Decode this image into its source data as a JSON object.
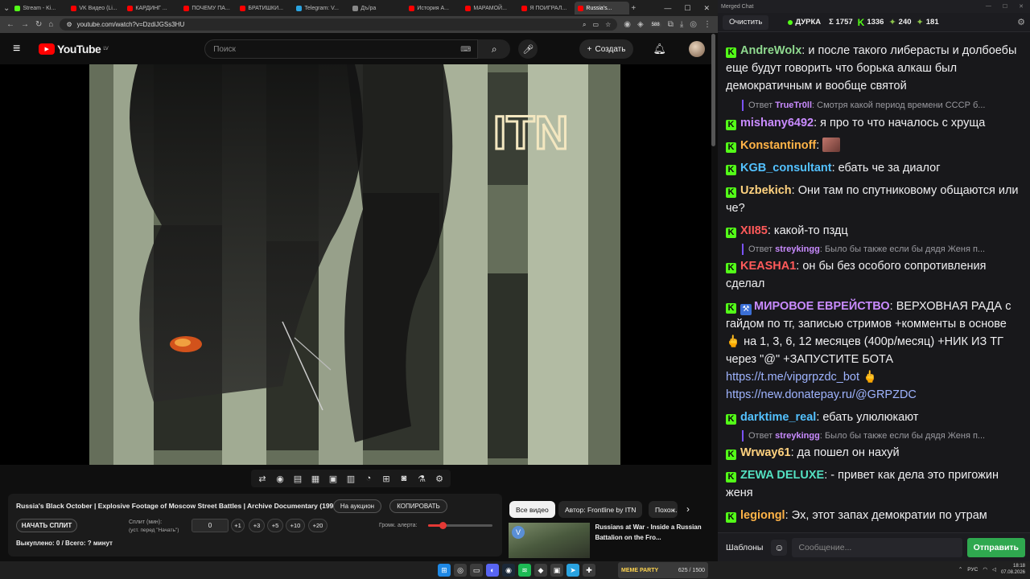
{
  "browser": {
    "tabs": [
      {
        "label": "Stream - Ki...",
        "color": "#53fc18"
      },
      {
        "label": "VK Видео (Li...",
        "color": "#ff0000"
      },
      {
        "label": "КАРДИНГ ...",
        "color": "#ff0000"
      },
      {
        "label": "ПОЧЕМУ ПА...",
        "color": "#ff0000"
      },
      {
        "label": "БРАТИШКИ...",
        "color": "#ff0000"
      },
      {
        "label": "Telegram: V...",
        "color": "#2aa3e0"
      },
      {
        "label": "Дъ/pa",
        "color": "#888888"
      },
      {
        "label": "История А...",
        "color": "#ff0000"
      },
      {
        "label": "МАРАМОЙ...",
        "color": "#ff0000"
      },
      {
        "label": "Я ПОИГРАЛ...",
        "color": "#ff0000"
      },
      {
        "label": "Russia's...",
        "color": "#ff0000"
      }
    ],
    "url": "youtube.com/watch?v=DzdiJGSs3HU",
    "badge": "588"
  },
  "youtube": {
    "logo_text": "YouTube",
    "logo_region": "LV",
    "search_placeholder": "Поиск",
    "create_label": "Создать",
    "video_watermark": "ITN"
  },
  "extension": {
    "video_title": "Russia's Black October | Explosive Footage of Moscow Street Battles | Archive Documentary (1993)",
    "auction_label": "На аукцион",
    "copy_label": "КОПИРОВАТЬ",
    "start_split_label": "НАЧАТЬ СПЛИТ",
    "split_label": "Сплит (мин):",
    "split_hint": "(уст. перед \"Начать\")",
    "split_value": "0",
    "steps": [
      "+1",
      "+3",
      "+5",
      "+10",
      "+20"
    ],
    "alert_volume_label": "Громк. алерта:",
    "alert_volume_percent": 23,
    "bought_label": "Выкуплено: 0 / Всего: ? минут"
  },
  "recommendations": {
    "chips": [
      "Все видео",
      "Автор: Frontline by ITN",
      "Похож..."
    ],
    "video_title": "Russians at War - Inside a Russian Battalion on the Fro..."
  },
  "taskbar": {
    "game_label": "MEME PARTY",
    "game_progress": "625 / 1500",
    "lang": "РУС",
    "time": "18:18",
    "date": "07.08.2026"
  },
  "chat": {
    "window_title": "Merged Chat",
    "clear_label": "Очистить",
    "channel": "ДУРКА",
    "stat_total": "Σ 1757",
    "stat_kick": "1336",
    "stat_a": "240",
    "stat_b": "181",
    "messages": [
      {
        "user": "AndreWolx",
        "color": "#8fd98f",
        "text": "и после такого либерасты и долбоебы еще будут говорить что борька алкаш был демократичным и вообще святой"
      },
      {
        "reply_user": "TrueTr0ll",
        "reply_text": "Смотря какой период времени СССР б..."
      },
      {
        "user": "mishany6492",
        "color": "#c98bff",
        "text": "я про то что началось с хруща"
      },
      {
        "user": "Konstantinoff",
        "color": "#ffb347",
        "text": ""
      },
      {
        "user": "KGB_consultant",
        "color": "#53c1ff",
        "text": "ебать  че за диалог"
      },
      {
        "user": "Uzbekich",
        "color": "#ffd27f",
        "text": "Они там по спутниковому общаются или че?"
      },
      {
        "user": "XII85",
        "color": "#ff5a5a",
        "text": "какой-то пздц"
      },
      {
        "reply_user": "streykingg",
        "reply_text": "Было бы также если бы дядя Женя п..."
      },
      {
        "user": "KEASHA1",
        "color": "#ff5a5a",
        "text": "он бы без особого сопротивления сделал"
      },
      {
        "user": "МИРОВОЕ ЕВРЕЙСТВО",
        "color": "#c98bff",
        "text": "ВЕРХОВНАЯ РАДА с гайдом по тг, записью стримов +комменты в основе 🖕 на 1, 3, 6, 12 месяцев (400р/месяц) +НИК ИЗ ТГ через \"@\" +ЗАПУСТИТЕ БОТА",
        "link1": "https://t.me/vipgrpzdc_bot",
        "link2": "https://new.donatepay.ru/@GRPZDC"
      },
      {
        "user": "darktime_real",
        "color": "#53c1ff",
        "text": "ебать улюлюкают"
      },
      {
        "reply_user": "streykingg",
        "reply_text": "Было бы также если бы дядя Женя п..."
      },
      {
        "user": "Wrway61",
        "color": "#ffd27f",
        "text": "да пошел он нахуй"
      },
      {
        "user": "ZEWA DELUXE",
        "color": "#53e0c1",
        "text": "- привет как дела это пригожин женя"
      },
      {
        "user": "legiongl",
        "color": "#ffb347",
        "text": "Эх, этот запах демократии по утрам"
      }
    ],
    "templates_label": "Шаблоны",
    "input_placeholder": "Сообщение...",
    "send_label": "Отправить"
  }
}
